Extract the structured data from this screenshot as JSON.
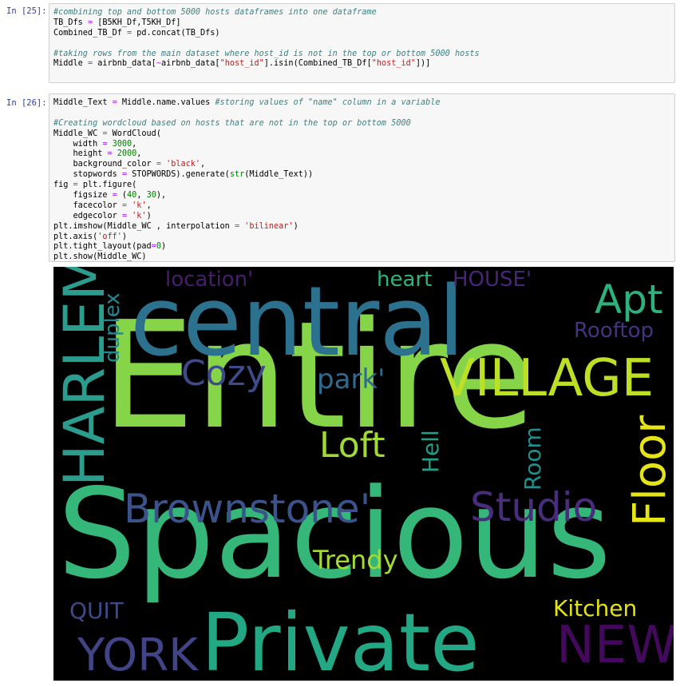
{
  "cells": [
    {
      "prompt": "In [25]:",
      "lines": [
        [
          {
            "t": "#combining top and bottom 5000 hosts dataframes into one dataframe",
            "c": "com"
          }
        ],
        [
          {
            "t": "TB_Dfs ",
            "c": "txt"
          },
          {
            "t": "=",
            "c": "op"
          },
          {
            "t": " [B5KH_Df,T5KH_Df]",
            "c": "txt"
          }
        ],
        [
          {
            "t": "Combined_TB_Df ",
            "c": "txt"
          },
          {
            "t": "=",
            "c": "op"
          },
          {
            "t": " pd.concat(TB_Dfs)",
            "c": "txt"
          }
        ],
        [
          {
            "t": "",
            "c": "txt"
          }
        ],
        [
          {
            "t": "#taking rows from the main dataset where host_id is not in the top or bottom 5000 hosts",
            "c": "com"
          }
        ],
        [
          {
            "t": "Middle ",
            "c": "txt"
          },
          {
            "t": "=",
            "c": "op"
          },
          {
            "t": " airbnb_data[",
            "c": "txt"
          },
          {
            "t": "~",
            "c": "op"
          },
          {
            "t": "airbnb_data[",
            "c": "txt"
          },
          {
            "t": "\"host_id\"",
            "c": "str"
          },
          {
            "t": "].isin(Combined_TB_Df[",
            "c": "txt"
          },
          {
            "t": "\"host_id\"",
            "c": "str"
          },
          {
            "t": "])]",
            "c": "txt"
          }
        ]
      ]
    },
    {
      "prompt": "In [26]:",
      "lines": [
        [
          {
            "t": "Middle_Text ",
            "c": "txt"
          },
          {
            "t": "=",
            "c": "op"
          },
          {
            "t": " Middle.name.values ",
            "c": "txt"
          },
          {
            "t": "#storing values of \"name\" column in a variable",
            "c": "com"
          }
        ],
        [
          {
            "t": "",
            "c": "txt"
          }
        ],
        [
          {
            "t": "#Creating wordcloud based on hosts that are not in the top or bottom 5000",
            "c": "com"
          }
        ],
        [
          {
            "t": "Middle_WC ",
            "c": "txt"
          },
          {
            "t": "=",
            "c": "op"
          },
          {
            "t": " WordCloud(",
            "c": "txt"
          }
        ],
        [
          {
            "t": "    width ",
            "c": "txt"
          },
          {
            "t": "=",
            "c": "op"
          },
          {
            "t": " ",
            "c": "txt"
          },
          {
            "t": "3000",
            "c": "num"
          },
          {
            "t": ",",
            "c": "txt"
          }
        ],
        [
          {
            "t": "    height ",
            "c": "txt"
          },
          {
            "t": "=",
            "c": "op"
          },
          {
            "t": " ",
            "c": "txt"
          },
          {
            "t": "2000",
            "c": "num"
          },
          {
            "t": ",",
            "c": "txt"
          }
        ],
        [
          {
            "t": "    background_color ",
            "c": "txt"
          },
          {
            "t": "=",
            "c": "op"
          },
          {
            "t": " ",
            "c": "txt"
          },
          {
            "t": "'black'",
            "c": "str"
          },
          {
            "t": ",",
            "c": "txt"
          }
        ],
        [
          {
            "t": "    stopwords ",
            "c": "txt"
          },
          {
            "t": "=",
            "c": "op"
          },
          {
            "t": " STOPWORDS).generate(",
            "c": "txt"
          },
          {
            "t": "str",
            "c": "num"
          },
          {
            "t": "(Middle_Text))",
            "c": "txt"
          }
        ],
        [
          {
            "t": "fig ",
            "c": "txt"
          },
          {
            "t": "=",
            "c": "op"
          },
          {
            "t": " plt.figure(",
            "c": "txt"
          }
        ],
        [
          {
            "t": "    figsize ",
            "c": "txt"
          },
          {
            "t": "=",
            "c": "op"
          },
          {
            "t": " (",
            "c": "txt"
          },
          {
            "t": "40",
            "c": "num"
          },
          {
            "t": ", ",
            "c": "txt"
          },
          {
            "t": "30",
            "c": "num"
          },
          {
            "t": "),",
            "c": "txt"
          }
        ],
        [
          {
            "t": "    facecolor ",
            "c": "txt"
          },
          {
            "t": "=",
            "c": "op"
          },
          {
            "t": " ",
            "c": "txt"
          },
          {
            "t": "'k'",
            "c": "str"
          },
          {
            "t": ",",
            "c": "txt"
          }
        ],
        [
          {
            "t": "    edgecolor ",
            "c": "txt"
          },
          {
            "t": "=",
            "c": "op"
          },
          {
            "t": " ",
            "c": "txt"
          },
          {
            "t": "'k'",
            "c": "str"
          },
          {
            "t": ")",
            "c": "txt"
          }
        ],
        [
          {
            "t": "plt.imshow(Middle_WC , interpolation ",
            "c": "txt"
          },
          {
            "t": "=",
            "c": "op"
          },
          {
            "t": " ",
            "c": "txt"
          },
          {
            "t": "'bilinear'",
            "c": "str"
          },
          {
            "t": ")",
            "c": "txt"
          }
        ],
        [
          {
            "t": "plt.axis(",
            "c": "txt"
          },
          {
            "t": "'off'",
            "c": "str"
          },
          {
            "t": ")",
            "c": "txt"
          }
        ],
        [
          {
            "t": "plt.tight_layout(pad",
            "c": "txt"
          },
          {
            "t": "=",
            "c": "op"
          },
          {
            "t": "0",
            "c": "num"
          },
          {
            "t": ")",
            "c": "txt"
          }
        ],
        [
          {
            "t": "plt.show(Middle_WC)",
            "c": "txt"
          }
        ]
      ]
    }
  ],
  "wordcloud": {
    "background": "#000000",
    "words": [
      {
        "text": "Entire",
        "color": "#86d549"
      },
      {
        "text": "Spacious",
        "color": "#35b779"
      },
      {
        "text": "central",
        "color": "#2c728e"
      },
      {
        "text": "Private",
        "color": "#22a884"
      },
      {
        "text": "VILLAGE",
        "color": "#bddf26"
      },
      {
        "text": "HARLEM",
        "color": "#2a9d8f"
      },
      {
        "text": "Brownstone'",
        "color": "#3b528b"
      },
      {
        "text": "Studio",
        "color": "#472d7b"
      },
      {
        "text": "Floor",
        "color": "#e5e419"
      },
      {
        "text": "YORK",
        "color": "#414487"
      },
      {
        "text": "NEW",
        "color": "#44095d"
      },
      {
        "text": "Apt",
        "color": "#2db27d"
      },
      {
        "text": "Cozy",
        "color": "#3e4a89"
      },
      {
        "text": "Loft",
        "color": "#a0da39"
      },
      {
        "text": "Trendy",
        "color": "#a5db36"
      },
      {
        "text": "Kitchen",
        "color": "#e2e418"
      },
      {
        "text": "Rooftop",
        "color": "#46337f"
      },
      {
        "text": "heart",
        "color": "#2fb47c"
      },
      {
        "text": "HOUSE'",
        "color": "#482576"
      },
      {
        "text": "location'",
        "color": "#481c6e"
      },
      {
        "text": "duplex",
        "color": "#24878e"
      },
      {
        "text": "park'",
        "color": "#2f6b8e"
      },
      {
        "text": "Hell",
        "color": "#1fa188"
      },
      {
        "text": "Room",
        "color": "#218f8d"
      },
      {
        "text": "QUIT",
        "color": "#3e4989"
      }
    ]
  }
}
